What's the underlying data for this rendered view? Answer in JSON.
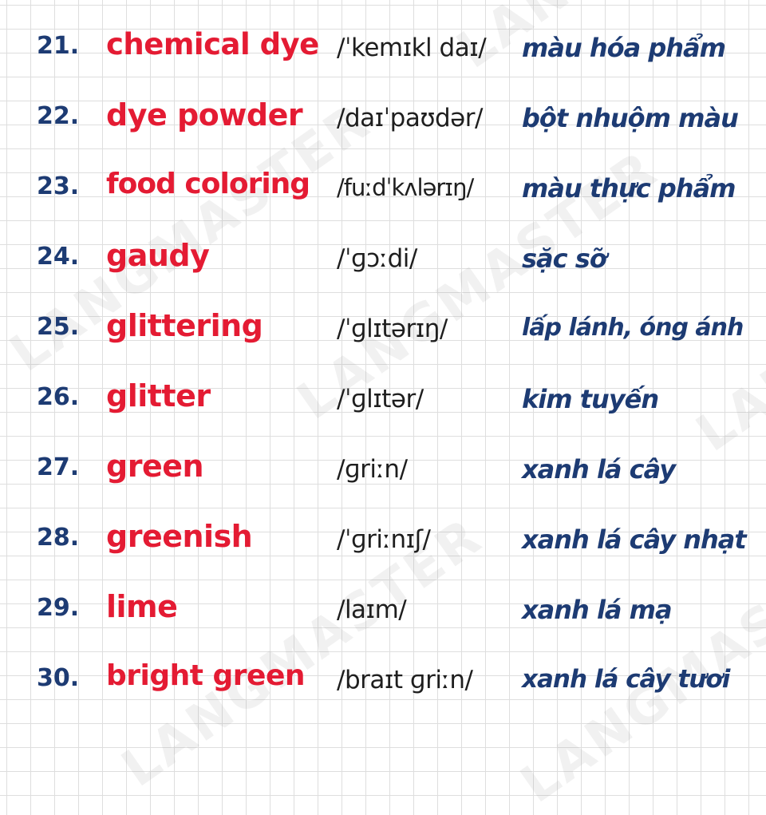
{
  "watermark": "LANGMASTER",
  "vocabulary": [
    {
      "number": "21.",
      "word": "chemical dye",
      "ipa": "/ˈkemɪkl daɪ/",
      "meaning": "màu hóa phẩm"
    },
    {
      "number": "22.",
      "word": "dye powder",
      "ipa": "/daɪˈpaʊdər/",
      "meaning": "bột nhuộm màu"
    },
    {
      "number": "23.",
      "word": "food coloring",
      "ipa": "/fuːdˈkʌlərɪŋ/",
      "meaning": "màu thực phẩm"
    },
    {
      "number": "24.",
      "word": "gaudy",
      "ipa": "/ˈɡɔːdi/",
      "meaning": "sặc sỡ"
    },
    {
      "number": "25.",
      "word": "glittering",
      "ipa": "/ˈɡlɪtərɪŋ/",
      "meaning": "lấp lánh, óng ánh"
    },
    {
      "number": "26.",
      "word": "glitter",
      "ipa": "/ˈɡlɪtər/",
      "meaning": "kim tuyến"
    },
    {
      "number": "27.",
      "word": "green",
      "ipa": "/ɡriːn/",
      "meaning": "xanh lá cây"
    },
    {
      "number": "28.",
      "word": "greenish",
      "ipa": "/ˈɡriːnɪʃ/",
      "meaning": "xanh lá cây nhạt"
    },
    {
      "number": "29.",
      "word": "lime",
      "ipa": "/laɪm/",
      "meaning": "xanh lá mạ"
    },
    {
      "number": "30.",
      "word": "bright green",
      "ipa": "/braɪt ɡriːn/",
      "meaning": "xanh lá cây tươi"
    }
  ],
  "colors": {
    "number": "#1d3b73",
    "word": "#e41b33",
    "ipa": "#1e1e1e",
    "meaning": "#1d3b73",
    "grid": "#dedede",
    "background": "#ffffff"
  }
}
